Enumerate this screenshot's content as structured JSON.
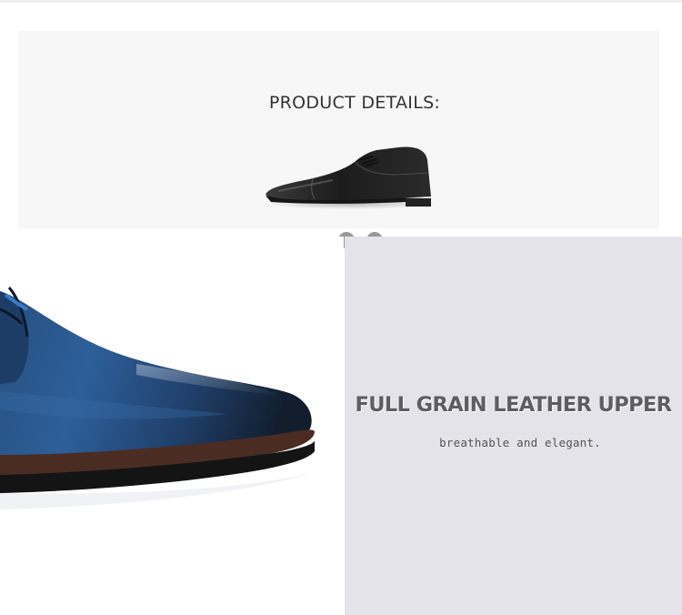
{
  "details": {
    "title": "PRODUCT DETAILS:",
    "carousel_dot_count": 2
  },
  "feature": {
    "title": "FULL GRAIN LEATHER UPPER",
    "subtitle": "breathable and elegant."
  },
  "colors": {
    "panel_background": "#f7f7f7",
    "feature_background": "#e4e3e9",
    "title_text": "#333333",
    "feature_title_text": "#5d5d62",
    "carousel_dot": "#999999",
    "shoe_leather_blue": "#1f4f86",
    "thumbnail_leather_black": "#1a1a1a"
  }
}
